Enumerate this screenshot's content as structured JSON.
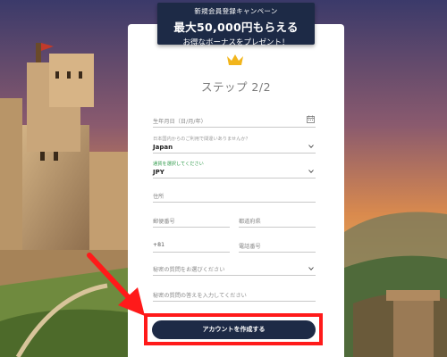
{
  "banner": {
    "line1": "新規会員登録キャンペーン",
    "line2": "最大50,000円もらえる",
    "line3": "お得なボーナスをプレゼント！"
  },
  "form": {
    "step_title": "ステップ 2/2",
    "birthdate": {
      "placeholder": "生年月日（日/月/年）",
      "icon": "calendar-icon"
    },
    "residence": {
      "label": "日本国内からのご利用で間違いありませんか？",
      "value": "Japan"
    },
    "currency": {
      "label": "通貨を選択してください",
      "value": "JPY"
    },
    "address": {
      "placeholder": "住所"
    },
    "postcode": {
      "placeholder": "郵便番号"
    },
    "city": {
      "placeholder": "都道府県"
    },
    "phone_code": {
      "value": "+81"
    },
    "phone": {
      "placeholder": "電話番号"
    },
    "security_question": {
      "placeholder": "秘密の質問をお選びください"
    },
    "security_answer": {
      "placeholder": "秘密の質問の答えを入力してください"
    },
    "submit_label": "アカウントを作成する"
  },
  "colors": {
    "navy": "#1d2a46",
    "highlight": "#ff1a1a",
    "crown": "#f2b51c",
    "accent_green": "#2f9a4a"
  }
}
